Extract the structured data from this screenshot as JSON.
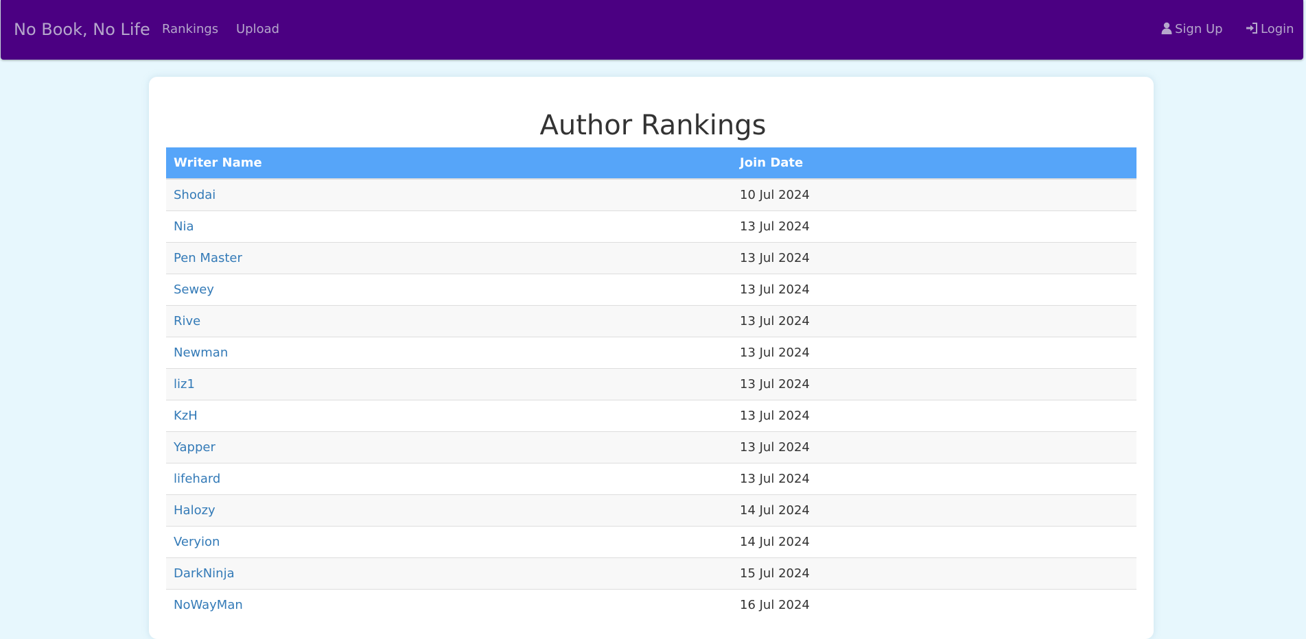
{
  "navbar": {
    "brand": "No Book, No Life",
    "links": [
      {
        "label": "Rankings"
      },
      {
        "label": "Upload"
      }
    ],
    "signup_label": "Sign Up",
    "login_label": "Login",
    "icons": {
      "signup": "user-icon",
      "login": "login-icon"
    },
    "background_color": "#4b0082"
  },
  "main": {
    "title": "Author Rankings",
    "table": {
      "headers": [
        "Writer Name",
        "Join Date"
      ],
      "header_color": "#56a5f9",
      "rows": [
        {
          "name": "Shodai",
          "date": "10 Jul 2024"
        },
        {
          "name": "Nia",
          "date": "13 Jul 2024"
        },
        {
          "name": "Pen Master",
          "date": "13 Jul 2024"
        },
        {
          "name": "Sewey",
          "date": "13 Jul 2024"
        },
        {
          "name": "Rive",
          "date": "13 Jul 2024"
        },
        {
          "name": "Newman",
          "date": "13 Jul 2024"
        },
        {
          "name": "liz1",
          "date": "13 Jul 2024"
        },
        {
          "name": "KzH",
          "date": "13 Jul 2024"
        },
        {
          "name": "Yapper",
          "date": "13 Jul 2024"
        },
        {
          "name": "lifehard",
          "date": "13 Jul 2024"
        },
        {
          "name": "Halozy",
          "date": "14 Jul 2024"
        },
        {
          "name": "Veryion",
          "date": "14 Jul 2024"
        },
        {
          "name": "DarkNinja",
          "date": "15 Jul 2024"
        },
        {
          "name": "NoWayMan",
          "date": "16 Jul 2024"
        }
      ]
    }
  }
}
